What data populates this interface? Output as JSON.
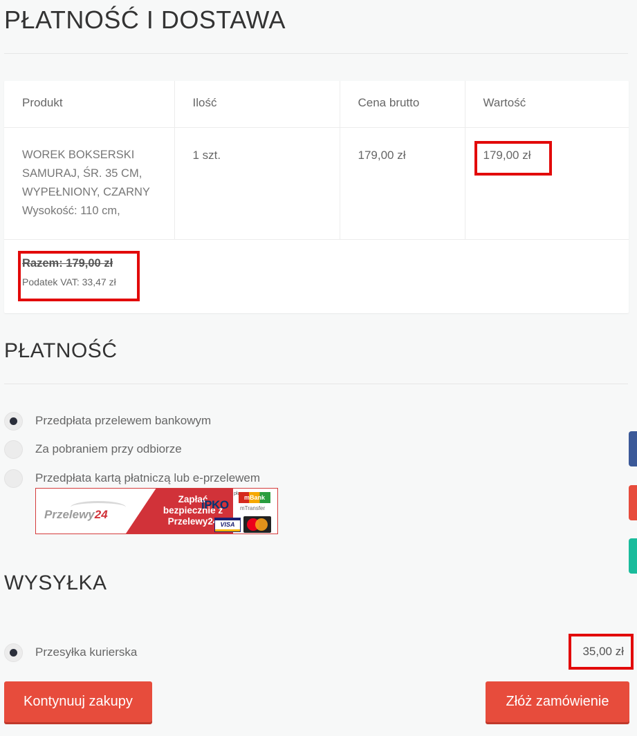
{
  "page": {
    "title": "PŁATNOŚĆ I DOSTAWA"
  },
  "cart": {
    "headers": [
      "Produkt",
      "Ilość",
      "Cena brutto",
      "Wartość"
    ],
    "rows": [
      {
        "product_name": "WOREK BOKSERSKI SAMURAJ, ŚR. 35 CM, WYPEŁNIONY, CZARNY",
        "product_attr": "Wysokość: 110 cm,",
        "quantity": "1 szt.",
        "price": "179,00 zł",
        "value": "179,00 zł"
      }
    ],
    "summary": {
      "total": "Razem: 179,00 zł",
      "vat": "Podatek VAT: 33,47 zł"
    }
  },
  "payment": {
    "title": "PŁATNOŚĆ",
    "options": [
      {
        "label": "Przedpłata przelewem bankowym",
        "selected": true
      },
      {
        "label": "Za pobraniem przy odbiorze",
        "selected": false
      },
      {
        "label": "Przedpłata kartą płatniczą lub e-przelewem",
        "selected": false
      }
    ],
    "banner": {
      "logo_main": "Przelewy",
      "logo_num": "24",
      "slogan": "Zapłać bezpiecznie z Przelewy24",
      "ipko_small": "płacę z",
      "ipko": "iPKO",
      "mbank": "mBank",
      "mtransfer": "mTransfer",
      "visa": "VISA"
    }
  },
  "shipping": {
    "title": "WYSYŁKA",
    "options": [
      {
        "label": "Przesyłka kurierska",
        "selected": true,
        "price": "35,00 zł"
      }
    ]
  },
  "actions": {
    "continue_label": "Kontynuuj zakupy",
    "order_label": "Złóż zamówienie"
  },
  "colors": {
    "accent": "#e74c3c",
    "highlight_box": "#e20a0a",
    "tab_facebook": "#3b5998",
    "tab_red": "#e74c3c",
    "tab_green": "#1abc9c"
  }
}
